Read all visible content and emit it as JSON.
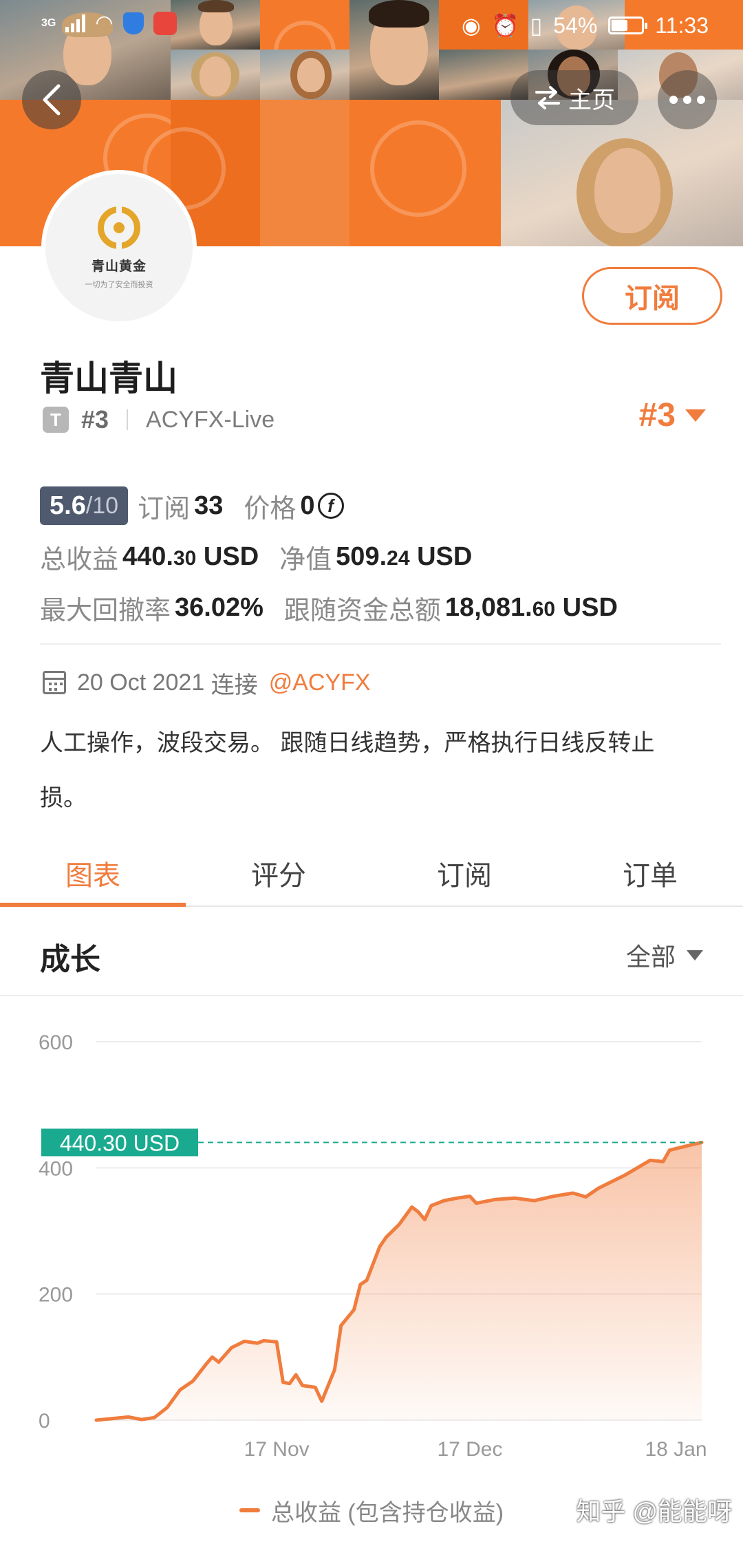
{
  "status_bar": {
    "network": "3G",
    "battery": "54%",
    "battery_level": 0.54,
    "time": "11:33"
  },
  "nav": {
    "home_label": "主页"
  },
  "profile": {
    "logo_title": "青山黄金",
    "logo_subtitle": "一切为了安全而投资",
    "subscribe_label": "订阅",
    "name": "青山青山",
    "badge_letter": "T",
    "rank_small": "#3",
    "broker": "ACYFX-Live",
    "rank_big": "#3"
  },
  "stats": {
    "score": "5.6",
    "score_max": "/10",
    "subscribers_label": "订阅",
    "subscribers_value": "33",
    "price_label": "价格",
    "price_value": "0",
    "coin_symbol": "f",
    "total_profit_label": "总收益",
    "total_profit_int": "440.",
    "total_profit_dec": "30",
    "total_profit_unit": "USD",
    "equity_label": "净值",
    "equity_int": "509.",
    "equity_dec": "24",
    "equity_unit": "USD",
    "drawdown_label": "最大回撤率",
    "drawdown_value": "36.02%",
    "follow_funds_label": "跟随资金总额",
    "follow_funds_int": "18,081.",
    "follow_funds_dec": "60",
    "follow_funds_unit": "USD"
  },
  "connection": {
    "date": "20 Oct 2021",
    "connect_label": "连接",
    "broker_link": "@ACYFX"
  },
  "description": "人工操作，波段交易。 跟随日线趋势，严格执行日线反转止损。",
  "tabs": [
    {
      "label": "图表",
      "active": true
    },
    {
      "label": "评分",
      "active": false
    },
    {
      "label": "订阅",
      "active": false
    },
    {
      "label": "订单",
      "active": false
    }
  ],
  "growth": {
    "title": "成长",
    "range": "全部"
  },
  "chart_data": {
    "type": "area",
    "x_ticks": [
      "17 Nov",
      "17 Dec",
      "18 Jan"
    ],
    "y_ticks": [
      0,
      200,
      400,
      600
    ],
    "ylim": [
      0,
      600
    ],
    "current_label": "440.30 USD",
    "current_value": 440.3,
    "legend": "总收益 (包含持仓收益)",
    "color": "#f07c3d",
    "label_color": "#1aaa8f",
    "x_range": [
      "2021-10-20",
      "2022-01-22"
    ],
    "points": [
      [
        "2021-10-20",
        0
      ],
      [
        "2021-10-23",
        3
      ],
      [
        "2021-10-25",
        5
      ],
      [
        "2021-10-27",
        1
      ],
      [
        "2021-10-29",
        4
      ],
      [
        "2021-10-31",
        20
      ],
      [
        "2021-11-02",
        48
      ],
      [
        "2021-11-04",
        62
      ],
      [
        "2021-11-06",
        88
      ],
      [
        "2021-11-07",
        100
      ],
      [
        "2021-11-08",
        92
      ],
      [
        "2021-11-10",
        115
      ],
      [
        "2021-11-12",
        125
      ],
      [
        "2021-11-14",
        122
      ],
      [
        "2021-11-15",
        126
      ],
      [
        "2021-11-17",
        124
      ],
      [
        "2021-11-18",
        60
      ],
      [
        "2021-11-19",
        58
      ],
      [
        "2021-11-20",
        72
      ],
      [
        "2021-11-21",
        55
      ],
      [
        "2021-11-23",
        52
      ],
      [
        "2021-11-24",
        30
      ],
      [
        "2021-11-26",
        80
      ],
      [
        "2021-11-27",
        150
      ],
      [
        "2021-11-29",
        175
      ],
      [
        "2021-11-30",
        215
      ],
      [
        "2021-12-01",
        222
      ],
      [
        "2021-12-03",
        275
      ],
      [
        "2021-12-04",
        290
      ],
      [
        "2021-12-06",
        310
      ],
      [
        "2021-12-08",
        338
      ],
      [
        "2021-12-09",
        330
      ],
      [
        "2021-12-10",
        318
      ],
      [
        "2021-12-11",
        340
      ],
      [
        "2021-12-13",
        348
      ],
      [
        "2021-12-15",
        352
      ],
      [
        "2021-12-17",
        355
      ],
      [
        "2021-12-18",
        344
      ],
      [
        "2021-12-21",
        350
      ],
      [
        "2021-12-24",
        352
      ],
      [
        "2021-12-27",
        348
      ],
      [
        "2021-12-30",
        355
      ],
      [
        "2022-01-02",
        360
      ],
      [
        "2022-01-04",
        354
      ],
      [
        "2022-01-06",
        368
      ],
      [
        "2022-01-08",
        378
      ],
      [
        "2022-01-10",
        388
      ],
      [
        "2022-01-12",
        400
      ],
      [
        "2022-01-14",
        412
      ],
      [
        "2022-01-16",
        410
      ],
      [
        "2022-01-17",
        428
      ],
      [
        "2022-01-19",
        433
      ],
      [
        "2022-01-21",
        438
      ],
      [
        "2022-01-22",
        440.3
      ]
    ]
  },
  "watermark": "知乎 @能能呀"
}
